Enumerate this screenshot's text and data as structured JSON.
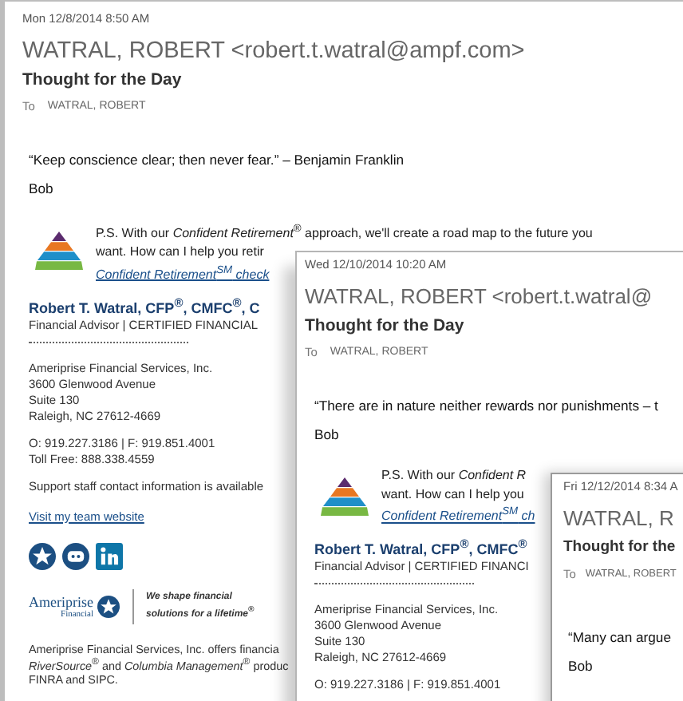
{
  "windows": [
    {
      "date": "Mon 12/8/2014 8:50 AM",
      "sender": "WATRAL, ROBERT <robert.t.watral@ampf.com>",
      "subject": "Thought for the Day",
      "to_label": "To",
      "to": "WATRAL, ROBERT",
      "body": [
        {
          "kind": "text",
          "text": "“Keep conscience clear; then never fear.” – Benjamin Franklin"
        },
        {
          "kind": "text",
          "text": "Bob"
        },
        {
          "kind": "ps",
          "lines": [
            "P.S. With our *Confident Retirement*$^{®}$ approach, we'll create a road map to the future you",
            "want. How can I help you retir"
          ],
          "link": "Confident Retirement$^{SM}$ check"
        },
        {
          "kind": "name",
          "text": "Robert T. Watral, CFP$^{®}$, CMFC$^{®}$, C"
        },
        {
          "kind": "title",
          "text": "Financial Advisor | CERTIFIED FINANCIAL"
        },
        {
          "kind": "rule"
        },
        {
          "kind": "sig",
          "lines": [
            "Ameriprise Financial Services, Inc.",
            "3600 Glenwood Avenue",
            "Suite 130",
            "Raleigh, NC 27612-4669"
          ]
        },
        {
          "kind": "sig",
          "lines": [
            "O: 919.227.3186 | F: 919.851.4001",
            "Toll Free: 888.338.4559"
          ]
        },
        {
          "kind": "sig",
          "lines": [
            "Support staff contact information is available"
          ]
        },
        {
          "kind": "link",
          "text": "Visit my team website"
        },
        {
          "kind": "social"
        },
        {
          "kind": "logo",
          "brand": "Ameriprise",
          "brand_sub": "Financial",
          "tagline": [
            "We shape financial",
            "solutions for a lifetime$^{®}$"
          ]
        },
        {
          "kind": "disclaimer",
          "lines": [
            "Ameriprise Financial Services, Inc. offers financia",
            "*RiverSource*$^{®}$ and *Columbia Management*$^{®}$ produc",
            "FINRA and SIPC."
          ]
        }
      ]
    },
    {
      "date": "Wed 12/10/2014 10:20 AM",
      "sender": "WATRAL, ROBERT <robert.t.watral@",
      "subject": "Thought for the Day",
      "to_label": "To",
      "to": "WATRAL, ROBERT",
      "body": [
        {
          "kind": "text",
          "text": "“There are in nature neither rewards nor punishments – t"
        },
        {
          "kind": "text",
          "text": "Bob"
        },
        {
          "kind": "ps",
          "lines": [
            "P.S. With our *Confident R*",
            "want. How can I help you"
          ],
          "link": "Confident Retirement$^{SM}$ ch"
        },
        {
          "kind": "name",
          "text": "Robert T. Watral, CFP$^{®}$, CMFC$^{®}$"
        },
        {
          "kind": "title",
          "text": "Financial Advisor | CERTIFIED FINANCI"
        },
        {
          "kind": "rule"
        },
        {
          "kind": "sig",
          "lines": [
            "Ameriprise Financial Services, Inc.",
            "3600 Glenwood Avenue",
            "Suite 130",
            "Raleigh, NC 27612-4669"
          ]
        },
        {
          "kind": "sig",
          "lines": [
            "O: 919.227.3186 | F: 919.851.4001"
          ]
        }
      ]
    },
    {
      "date": "Fri 12/12/2014 8:34 A",
      "sender": "WATRAL, R",
      "subject": "Thought for the",
      "to_label": "To",
      "to": "WATRAL, ROBERT",
      "body": [
        {
          "kind": "text",
          "text": "“Many can argue"
        },
        {
          "kind": "text",
          "text": "Bob"
        }
      ]
    }
  ]
}
